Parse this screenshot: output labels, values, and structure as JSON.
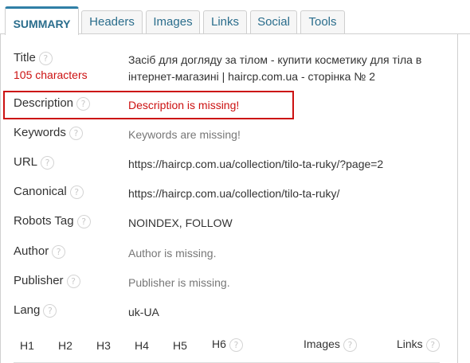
{
  "tabs": [
    {
      "label": "SUMMARY",
      "active": true
    },
    {
      "label": "Headers",
      "active": false
    },
    {
      "label": "Images",
      "active": false
    },
    {
      "label": "Links",
      "active": false
    },
    {
      "label": "Social",
      "active": false
    },
    {
      "label": "Tools",
      "active": false
    }
  ],
  "help_glyph": "?",
  "fields": {
    "title": {
      "label": "Title",
      "length": "105 characters",
      "value": "Засіб для догляду за тілом - купити косметику для тіла в інтернет-магазині | haircp.com.ua - сторінка № 2"
    },
    "description": {
      "label": "Description",
      "value": "Description is missing!"
    },
    "keywords": {
      "label": "Keywords",
      "value": "Keywords are missing!"
    },
    "url": {
      "label": "URL",
      "value": "https://haircp.com.ua/collection/tilo-ta-ruky/?page=2"
    },
    "canonical": {
      "label": "Canonical",
      "value": "https://haircp.com.ua/collection/tilo-ta-ruky/"
    },
    "robots": {
      "label": "Robots Tag",
      "value": "NOINDEX, FOLLOW"
    },
    "author": {
      "label": "Author",
      "value": "Author is missing."
    },
    "publisher": {
      "label": "Publisher",
      "value": "Publisher is missing."
    },
    "lang": {
      "label": "Lang",
      "value": "uk-UA"
    }
  },
  "headings_summary": {
    "columns": [
      "H1",
      "H2",
      "H3",
      "H4",
      "H5",
      "H6",
      "Images",
      "Links"
    ]
  },
  "colors": {
    "accent": "#2f7fa6",
    "error": "#cc1111",
    "muted": "#777777"
  }
}
